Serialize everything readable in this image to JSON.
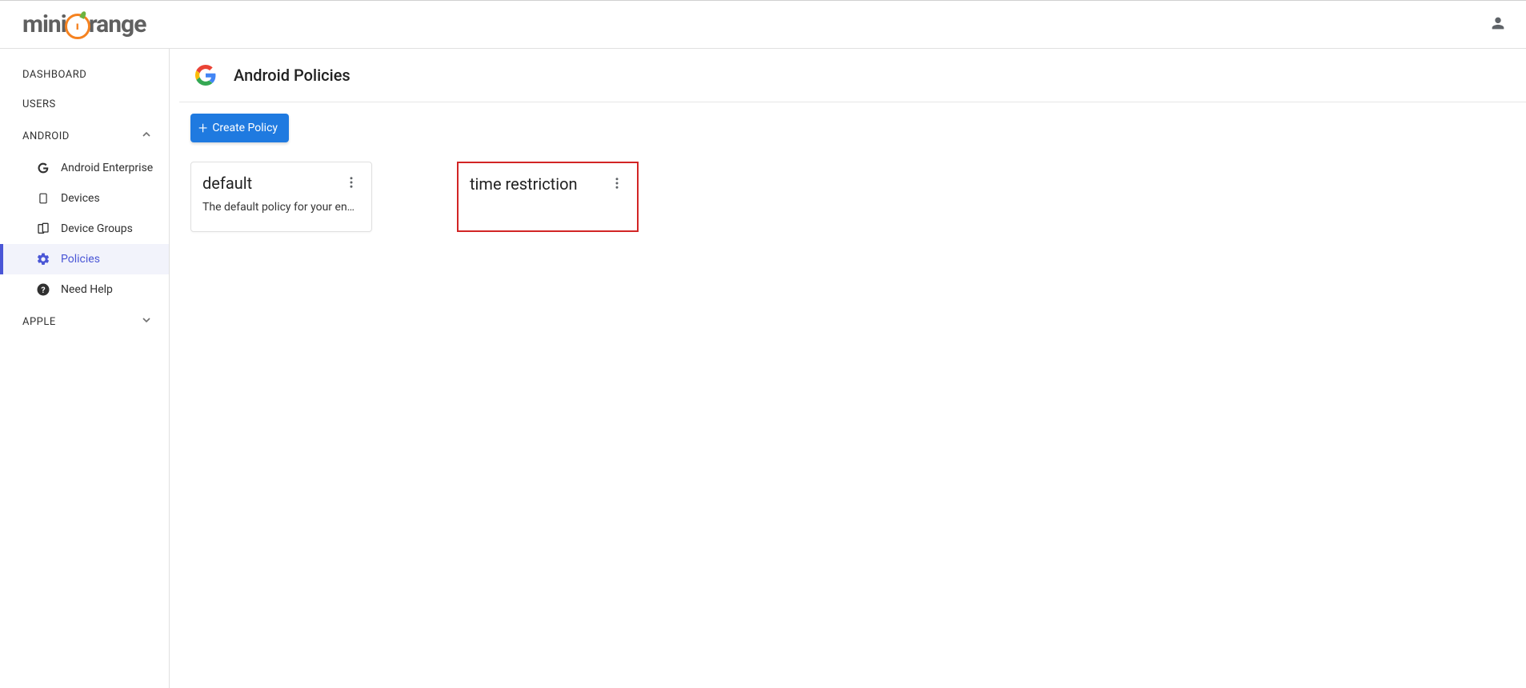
{
  "header": {
    "logo_parts": {
      "pre": "mini",
      "post": "range",
      "inner": "ı"
    }
  },
  "sidebar": {
    "dashboard": "DASHBOARD",
    "users": "USERS",
    "android": {
      "label": "ANDROID"
    },
    "android_items": {
      "enterprise": "Android Enterprise",
      "devices": "Devices",
      "device_groups": "Device Groups",
      "policies": "Policies",
      "need_help": "Need Help"
    },
    "apple": {
      "label": "APPLE"
    }
  },
  "page": {
    "title": "Android Policies",
    "create_button": "Create Policy"
  },
  "policies": [
    {
      "name": "default",
      "desc": "The default policy for your en…"
    },
    {
      "name": "time restriction",
      "desc": ""
    }
  ]
}
